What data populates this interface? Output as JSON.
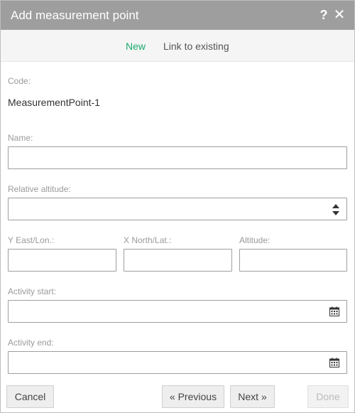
{
  "dialog": {
    "title": "Add measurement point",
    "help_symbol": "?",
    "close_symbol": "✕"
  },
  "tabs": [
    {
      "label": "New",
      "active": true
    },
    {
      "label": "Link to existing",
      "active": false
    }
  ],
  "form": {
    "code": {
      "label": "Code:",
      "value": "MeasurementPoint-1"
    },
    "name": {
      "label": "Name:",
      "value": ""
    },
    "relative_altitude": {
      "label": "Relative altitude:",
      "value": ""
    },
    "y_east_lon": {
      "label": "Y East/Lon.:",
      "value": ""
    },
    "x_north_lat": {
      "label": "X North/Lat.:",
      "value": ""
    },
    "altitude": {
      "label": "Altitude:",
      "value": ""
    },
    "activity_start": {
      "label": "Activity start:",
      "value": ""
    },
    "activity_end": {
      "label": "Activity end:",
      "value": ""
    }
  },
  "buttons": {
    "cancel": "Cancel",
    "previous": "« Previous",
    "next": "Next »",
    "done": "Done"
  },
  "colors": {
    "titlebar": "#9e9e9e",
    "accent": "#1aab6d",
    "tabbar": "#f5f5f5"
  },
  "icons": {
    "help": "help-icon",
    "close": "close-icon",
    "spinner": "spinner-icon",
    "calendar": "calendar-icon"
  }
}
